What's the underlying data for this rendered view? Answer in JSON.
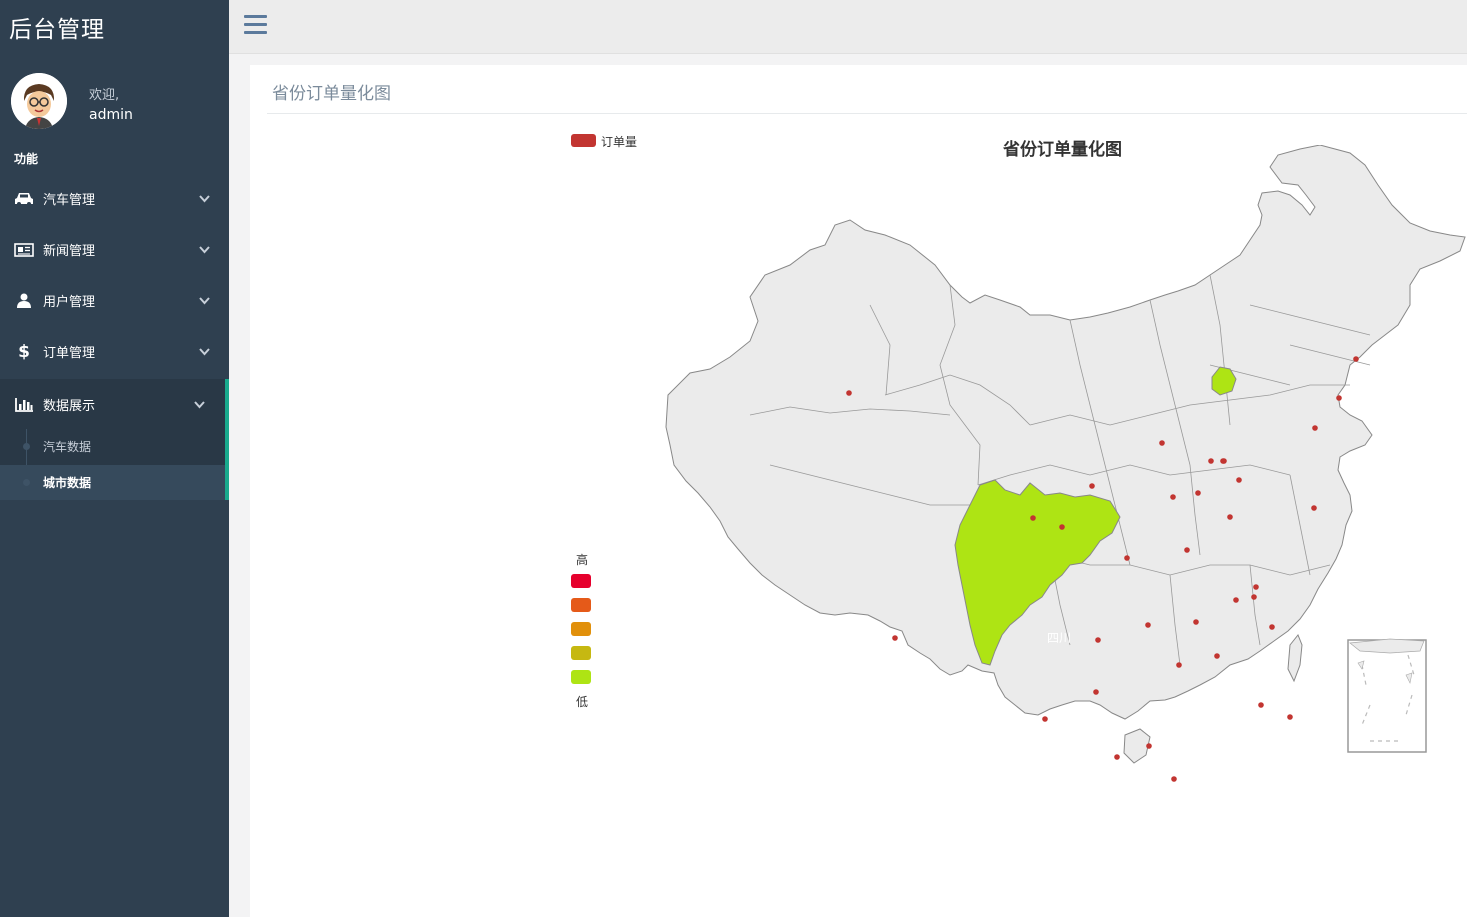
{
  "sidebar": {
    "brand": "后台管理",
    "welcome": "欢迎,",
    "username": "admin",
    "section_label": "功能",
    "menu": [
      {
        "label": "汽车管理",
        "icon": "car-icon"
      },
      {
        "label": "新闻管理",
        "icon": "newspaper-icon"
      },
      {
        "label": "用户管理",
        "icon": "user-icon"
      },
      {
        "label": "订单管理",
        "icon": "dollar-icon"
      },
      {
        "label": "数据展示",
        "icon": "bar-chart-icon"
      }
    ],
    "submenu": [
      {
        "label": "汽车数据"
      },
      {
        "label": "城市数据"
      }
    ]
  },
  "topbar": {
    "menu_icon": "hamburger-icon"
  },
  "panel": {
    "title": "省份订单量化图"
  },
  "chart_data": {
    "type": "map",
    "title": "省份订单量化图",
    "legend": [
      "订单量"
    ],
    "visual_map": {
      "high_label": "高",
      "low_label": "低",
      "colors": [
        "#e6002d",
        "#e55a19",
        "#e1900b",
        "#c6b811",
        "#aee414"
      ]
    },
    "highlighted_regions": [
      {
        "name": "四川",
        "color": "#aee414"
      },
      {
        "name": "北京",
        "color": "#aee414"
      }
    ],
    "visible_region_labels": [
      "四川"
    ]
  },
  "colors": {
    "sidebar_bg": "#2f4050",
    "active_accent": "#19aa8d",
    "series_color": "#c23531",
    "map_fill": "#ebebeb",
    "map_border": "#888888"
  }
}
